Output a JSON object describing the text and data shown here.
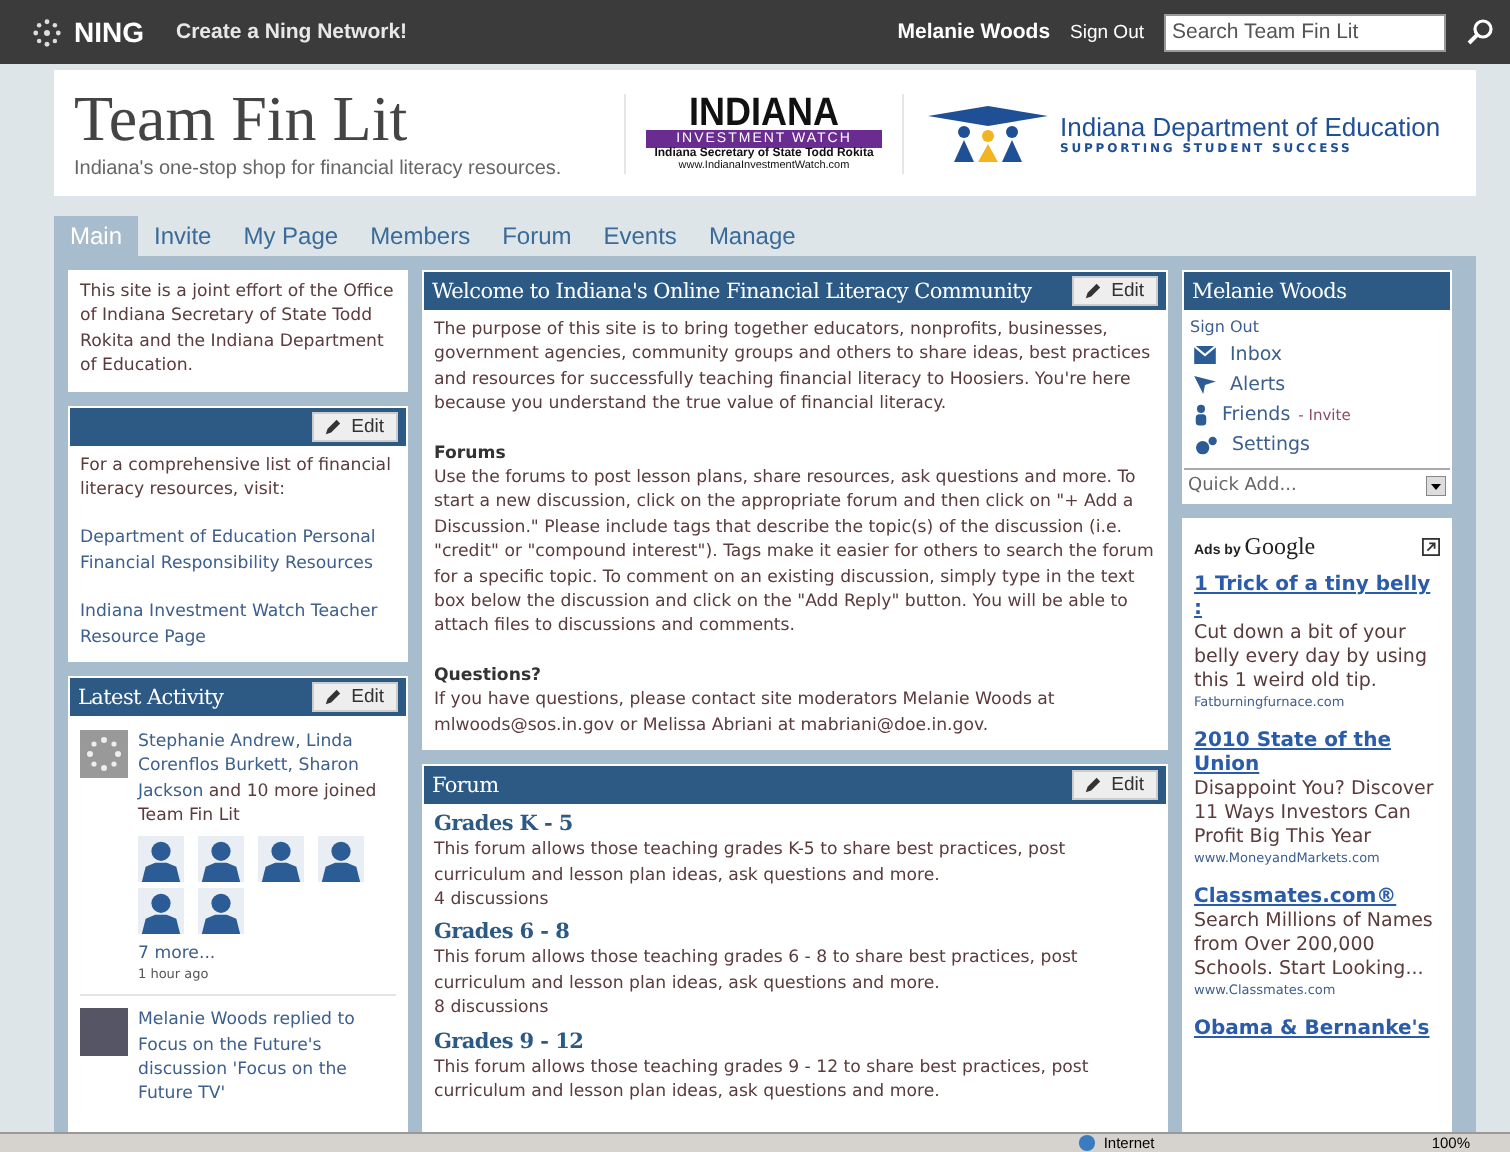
{
  "topbar": {
    "logo": "NING",
    "create_link": "Create a Ning Network!",
    "user": "Melanie Woods",
    "sign_out": "Sign Out",
    "search": {
      "placeholder": "Search Team Fin Lit"
    }
  },
  "header": {
    "title": "Team Fin Lit",
    "tagline": "Indiana's one-stop shop for financial literacy resources.",
    "iiw_logo": {
      "name": "INDIANA",
      "band": "INVESTMENT WATCH",
      "subtitle": "Indiana Secretary of State Todd Rokita",
      "url": "www.IndianaInvestmentWatch.com"
    },
    "doe_logo": {
      "name": "Indiana Department of Education",
      "motto": "SUPPORTING STUDENT SUCCESS"
    }
  },
  "tabs": [
    {
      "label": "Main",
      "selected": true
    },
    {
      "label": "Invite",
      "selected": false
    },
    {
      "label": "My Page",
      "selected": false
    },
    {
      "label": "Members",
      "selected": false
    },
    {
      "label": "Forum",
      "selected": false
    },
    {
      "label": "Events",
      "selected": false
    },
    {
      "label": "Manage",
      "selected": false
    }
  ],
  "left": {
    "about": "This site is a joint effort of the Office of Indiana Secretary of State Todd Rokita and the Indiana Department of Education.",
    "resources": {
      "edit": "Edit",
      "intro": "For a comprehensive list of financial literacy resources, visit:",
      "links": [
        "Department of Education Personal Financial Responsibility Resources",
        "Indiana Investment Watch Teacher Resource Page"
      ]
    },
    "activity": {
      "title": "Latest Activity",
      "edit": "Edit",
      "items": [
        {
          "kind": "joined",
          "actors": "Stephanie Andrew, Linda Corenflos Burkett, Sharon Jackson",
          "action": " and 10 more joined Team Fin Lit",
          "more": "7 more...",
          "time": "1 hour ago"
        },
        {
          "kind": "reply",
          "text": "Melanie Woods replied to Focus on the Future's discussion 'Focus on the Future TV'"
        }
      ]
    }
  },
  "welcome": {
    "title": "Welcome to Indiana's Online Financial Literacy Community",
    "edit": "Edit",
    "blocks": [
      {
        "kind": "text",
        "text": "The purpose of this site is to bring together educators, nonprofits, businesses, government agencies, community groups and others to share ideas, best practices and resources for successfully teaching financial literacy to Hoosiers. You're here because you understand the true value of financial literacy."
      },
      {
        "kind": "heading",
        "text": "Forums"
      },
      {
        "kind": "text",
        "text": "Use the forums to post lesson plans, share resources, ask questions and more. To start a new discussion, click on the appropriate forum and then click on \"+ Add a Discussion.\" Please include tags that describe the topic(s) of the discussion (i.e. \"credit\" or \"compound interest\"). Tags make it easier for others to search the forum for a specific topic. To comment on an existing discussion, simply type in the text box below the discussion and click on the \"Add Reply\" button. You will be able to attach files to discussions and comments."
      },
      {
        "kind": "heading",
        "text": "Questions?"
      },
      {
        "kind": "text",
        "text": "If you have questions, please contact site moderators Melanie Woods at mlwoods@sos.in.gov or Melissa Abriani at mabriani@doe.in.gov."
      }
    ]
  },
  "forum": {
    "title": "Forum",
    "edit": "Edit",
    "forums": [
      {
        "name": "Grades K - 5",
        "description": "This forum allows those teaching grades K-5 to share best practices, post curriculum and lesson plan ideas, ask questions and more.",
        "count": "4 discussions"
      },
      {
        "name": "Grades 6 - 8",
        "description": "This forum allows those teaching grades 6 - 8 to share best practices, post curriculum and lesson plan ideas, ask questions and more.",
        "count": "8 discussions"
      },
      {
        "name": "Grades 9 - 12",
        "description": "This forum allows those teaching grades 9 - 12 to share best practices, post curriculum and lesson plan ideas, ask questions and more."
      }
    ]
  },
  "user_box": {
    "name": "Melanie Woods",
    "sign_out": "Sign Out",
    "links": [
      {
        "kind": "inbox",
        "label": "Inbox"
      },
      {
        "kind": "alerts",
        "label": "Alerts"
      },
      {
        "kind": "friends",
        "label": "Friends",
        "extra": "- Invite"
      },
      {
        "kind": "settings",
        "label": "Settings"
      }
    ],
    "quick_add": "Quick Add..."
  },
  "ads": {
    "label": "Ads by",
    "brand": "Google",
    "items": [
      {
        "title": "1 Trick of a tiny belly :",
        "text": "Cut down a bit of your belly every day by using this 1 weird old tip.",
        "url": "Fatburningfurnace.com"
      },
      {
        "title": "2010 State of the Union",
        "text": "Disappoint You? Discover 11 Ways Investors Can Profit Big This Year",
        "url": "www.MoneyandMarkets.com"
      },
      {
        "title": "Classmates.com®",
        "text": "Search Millions of Names from Over 200,000 Schools. Start Looking...",
        "url": "www.Classmates.com"
      },
      {
        "title": "Obama & Bernanke's"
      }
    ]
  },
  "status_bar": {
    "zone": "Internet",
    "zoom": "100%"
  }
}
